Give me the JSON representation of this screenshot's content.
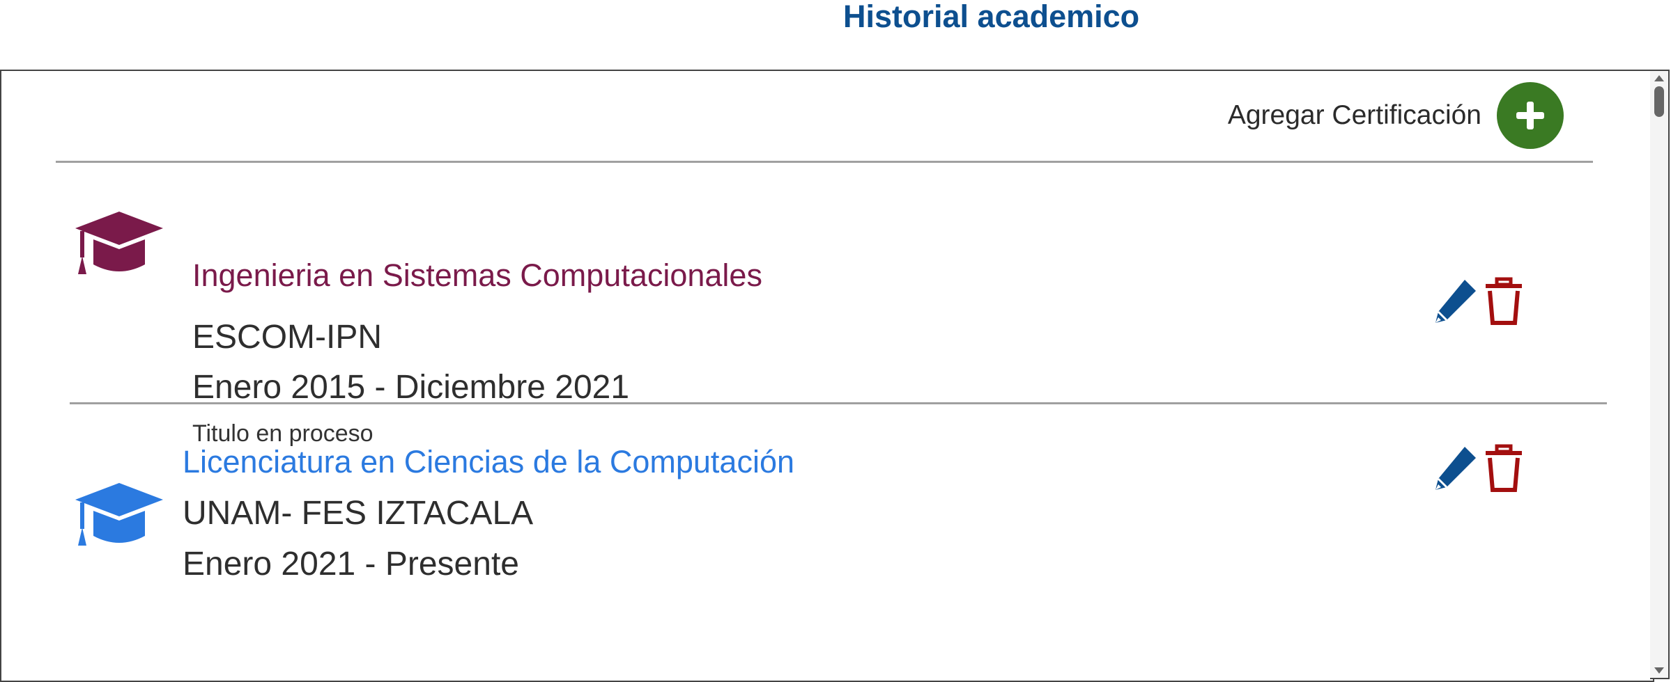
{
  "header": {
    "title": "Historial academico"
  },
  "toolbar": {
    "add_label": "Agregar Certificación"
  },
  "colors": {
    "title": "#0d4f8f",
    "add_button": "#3a7a23",
    "edit_icon": "#0d4f8f",
    "delete_icon": "#a30f0f",
    "entry1_accent": "#7a1a4a",
    "entry2_accent": "#2b7ae0"
  },
  "entries": [
    {
      "degree": "Ingenieria en Sistemas Computacionales",
      "school": "ESCOM-IPN",
      "dates": "Enero 2015 - Diciembre 2021",
      "status": "Titulo en proceso",
      "icon": "graduation-cap-icon"
    },
    {
      "degree": "Licenciatura en Ciencias de la Computación",
      "school": "UNAM- FES IZTACALA",
      "dates": "Enero 2021 - Presente",
      "icon": "graduation-cap-icon"
    }
  ],
  "actions": {
    "edit_icon": "pencil-icon",
    "delete_icon": "trash-icon"
  }
}
